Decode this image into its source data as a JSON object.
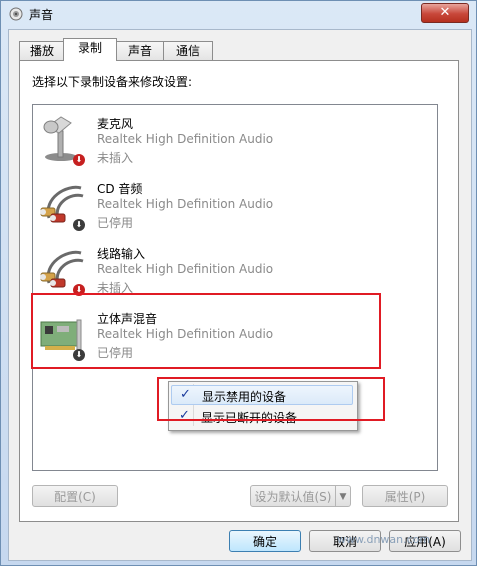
{
  "window": {
    "title": "声音",
    "close_label": "✕"
  },
  "tabs": [
    {
      "label": "播放"
    },
    {
      "label": "录制"
    },
    {
      "label": "声音"
    },
    {
      "label": "通信"
    }
  ],
  "active_tab": "录制",
  "instruction": "选择以下录制设备来修改设置:",
  "devices": [
    {
      "name": "麦克风",
      "driver": "Realtek High Definition Audio",
      "status": "未插入",
      "icon": "microphone-icon"
    },
    {
      "name": "CD 音频",
      "driver": "Realtek High Definition Audio",
      "status": "已停用",
      "icon": "rca-cable-icon"
    },
    {
      "name": "线路输入",
      "driver": "Realtek High Definition Audio",
      "status": "未插入",
      "icon": "rca-cable-icon"
    },
    {
      "name": "立体声混音",
      "driver": "Realtek High Definition Audio",
      "status": "已停用",
      "icon": "sound-card-icon"
    }
  ],
  "context_menu": {
    "items": [
      {
        "label": "显示禁用的设备",
        "checked": true
      },
      {
        "label": "显示已断开的设备",
        "checked": true
      }
    ],
    "check_glyph": "✓"
  },
  "buttons": {
    "configure": "配置(C)",
    "set_default": "设为默认值(S)",
    "properties": "属性(P)",
    "ok": "确定",
    "cancel": "取消",
    "apply": "应用(A)"
  },
  "watermark": {
    "text": "www.dnwan.com"
  },
  "colors": {
    "highlight": "#e01b24",
    "close_button": "#c8473a",
    "checkmark": "#1a3a9c"
  }
}
